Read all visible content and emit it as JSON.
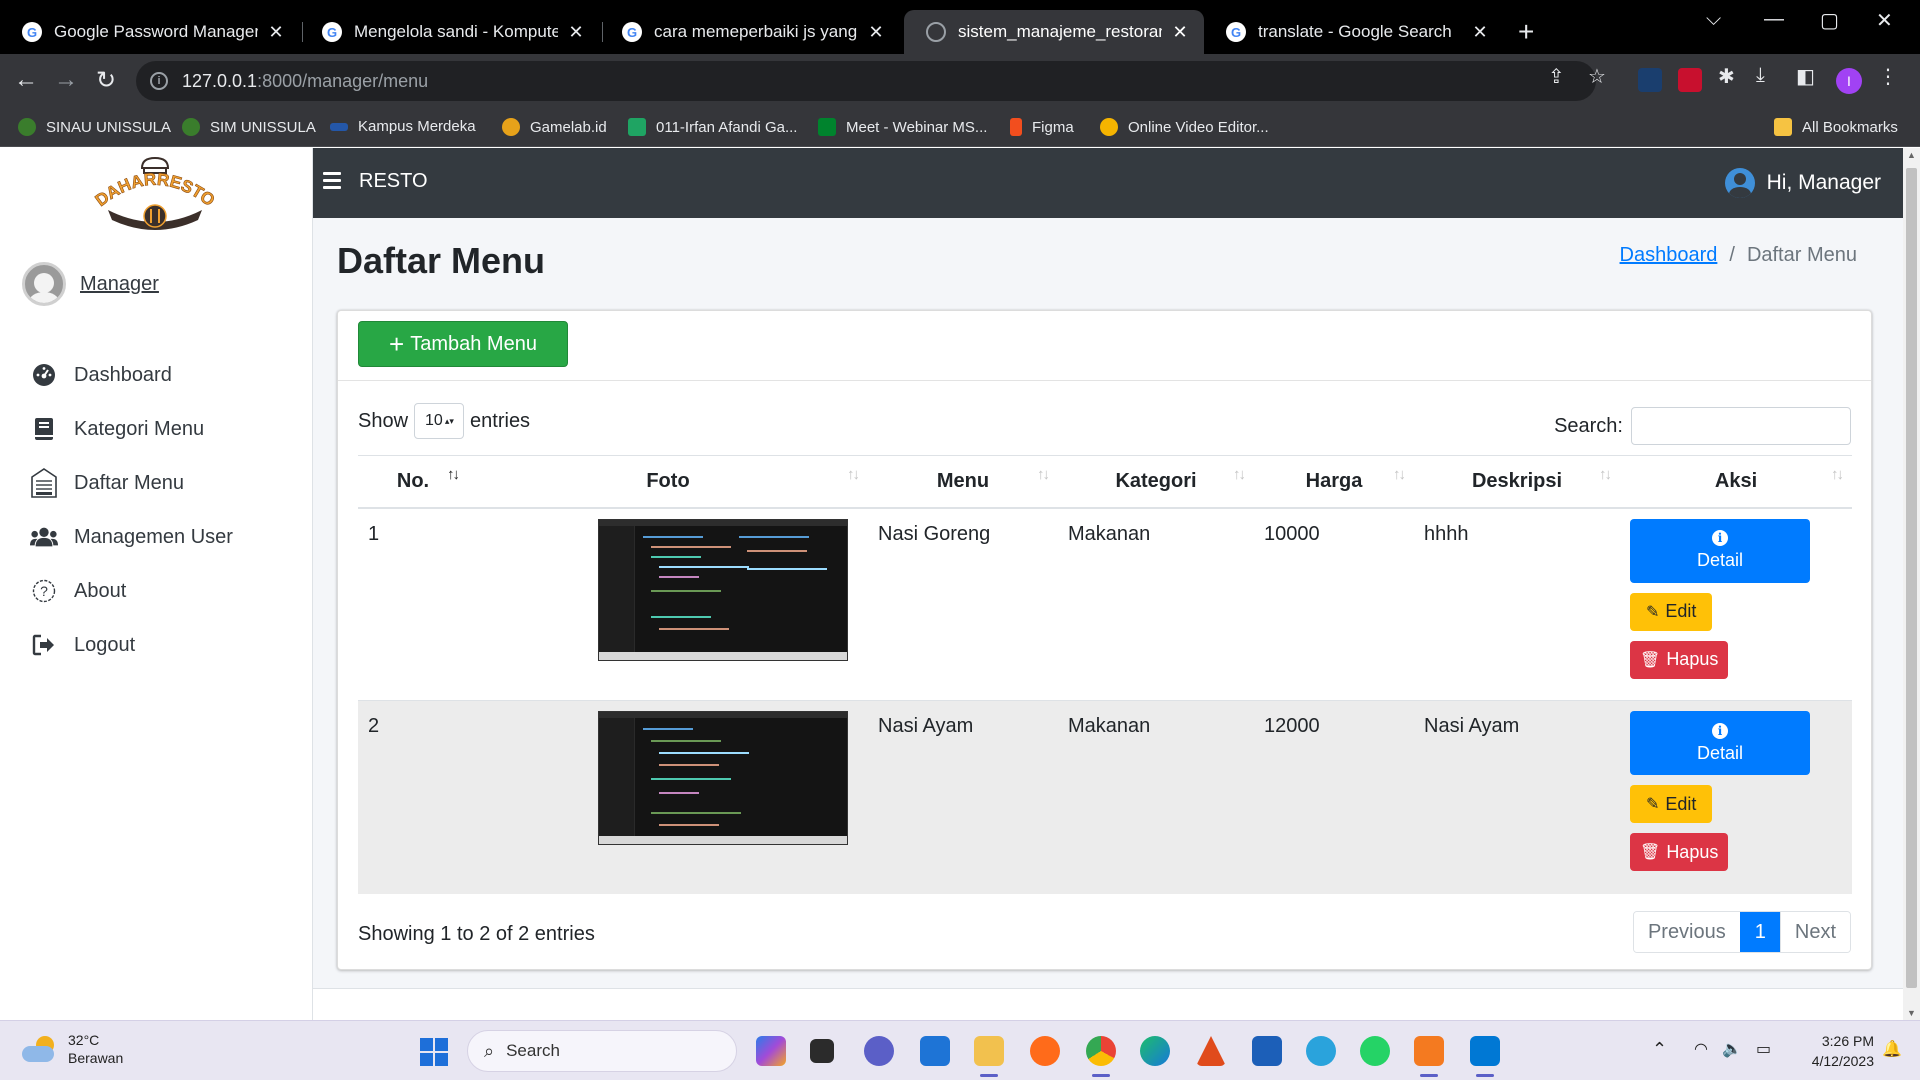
{
  "browser": {
    "tabs": [
      {
        "title": "Google Password Manager",
        "icon": "google-icon",
        "active": false
      },
      {
        "title": "Mengelola sandi - Komputer - Bantuan Google",
        "icon": "google-icon",
        "active": false
      },
      {
        "title": "cara memeperbaiki js yang tidak",
        "icon": "google-icon",
        "active": false
      },
      {
        "title": "sistem_manajeme_restoran_gambar",
        "icon": "globe-icon",
        "active": true
      },
      {
        "title": "translate - Google Search",
        "icon": "google-icon",
        "active": false
      }
    ],
    "url_host": "127.0.0.1",
    "url_path": ":8000/manager/menu",
    "bookmarks": [
      {
        "label": "SINAU UNISSULA",
        "color": "#3a7d2c"
      },
      {
        "label": "SIM UNISSULA",
        "color": "#3a7d2c"
      },
      {
        "label": "Kampus Merdeka",
        "color": "#2457a8"
      },
      {
        "label": "Gamelab.id",
        "color": "#e7a21a"
      },
      {
        "label": "011-Irfan Afandi Ga...",
        "color": "#1fa463"
      },
      {
        "label": "Meet - Webinar MS...",
        "color": "#00832d"
      },
      {
        "label": "Figma",
        "color": "#f24e1e"
      },
      {
        "label": "Online Video Editor...",
        "color": "#f5b400"
      }
    ],
    "all_bookmarks": "All Bookmarks",
    "profile_initial": "I"
  },
  "app": {
    "brand": "RESTO",
    "logo_text": "DAHARRESTO",
    "greeting": "Hi, Manager",
    "user_name": "Manager",
    "nav": [
      {
        "label": "Dashboard",
        "icon": "dashboard-icon",
        "glyph": "◔"
      },
      {
        "label": "Kategori Menu",
        "icon": "book-icon",
        "glyph": "▤"
      },
      {
        "label": "Daftar Menu",
        "icon": "menu-board-icon",
        "glyph": "▦"
      },
      {
        "label": "Managemen User",
        "icon": "users-icon",
        "glyph": "👥"
      },
      {
        "label": "About",
        "icon": "question-circle-icon",
        "glyph": "?"
      },
      {
        "label": "Logout",
        "icon": "logout-icon",
        "glyph": "⇥"
      }
    ]
  },
  "page": {
    "title": "Daftar Menu",
    "breadcrumb_link": "Dashboard",
    "breadcrumb_sep": "/",
    "breadcrumb_current": "Daftar Menu"
  },
  "card": {
    "add_button": "Tambah Menu",
    "show_label": "Show",
    "entries_label": "entries",
    "length_value": "10",
    "search_label": "Search:",
    "columns": [
      "No.",
      "Foto",
      "Menu",
      "Kategori",
      "Harga",
      "Deskripsi",
      "Aksi"
    ],
    "rows": [
      {
        "no": "1",
        "menu": "Nasi Goreng",
        "kategori": "Makanan",
        "harga": "10000",
        "deskripsi": "hhhh"
      },
      {
        "no": "2",
        "menu": "Nasi Ayam",
        "kategori": "Makanan",
        "harga": "12000",
        "deskripsi": "Nasi Ayam"
      }
    ],
    "btn_detail": "Detail",
    "btn_edit": "Edit",
    "btn_hapus": "Hapus",
    "info": "Showing 1 to 2 of 2 entries",
    "pager": {
      "previous": "Previous",
      "current": "1",
      "next": "Next"
    }
  },
  "taskbar": {
    "temperature": "32°C",
    "weather": "Berawan",
    "search_placeholder": "Search",
    "time": "3:26 PM",
    "date": "4/12/2023"
  },
  "colors": {
    "primary": "#007bff",
    "success": "#28a745",
    "warning": "#ffc107",
    "danger": "#dc3545",
    "navbar": "#343a40"
  }
}
